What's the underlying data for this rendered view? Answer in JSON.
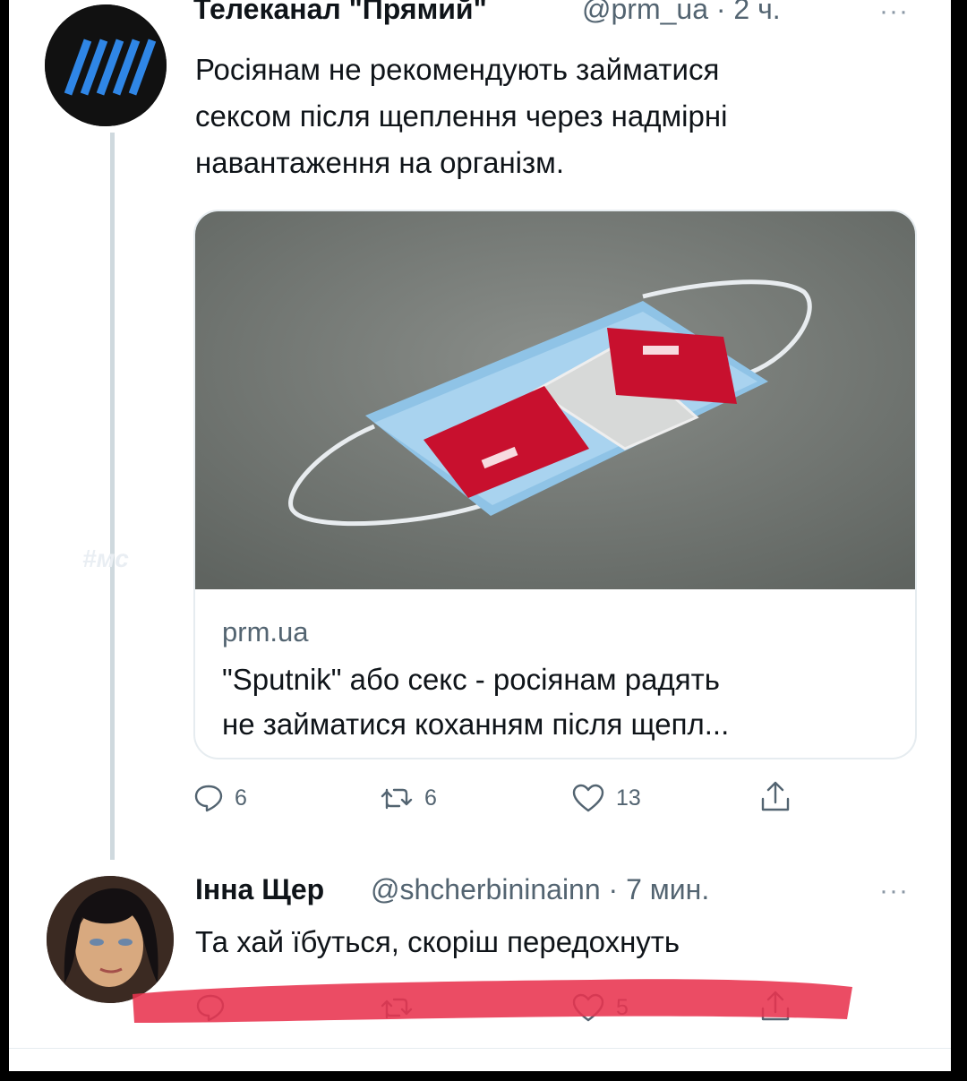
{
  "tweet1": {
    "display_name": "Телеканал \"Прямий\"",
    "meta": "@prm_ua · 2 ч.",
    "more": "···",
    "text_lines": [
      "Росіянам не рекомендують займатися",
      "сексом після щеплення через надмірні",
      "навантаження на організм."
    ],
    "card": {
      "domain": "prm.ua",
      "title_lines": [
        "\"Sputnik\" або секс - росіянам радять",
        "не займатися коханням після щепл..."
      ]
    },
    "actions": {
      "reply_count": "6",
      "retweet_count": "6",
      "like_count": "13"
    }
  },
  "tweet2": {
    "display_name": "Інна Щер",
    "meta": "@shcherbininainn · 7 мин.",
    "more": "···",
    "text": "Та хай їбуться, скоріш передохнуть",
    "actions": {
      "like_count": "5"
    }
  },
  "watermark": "#мс",
  "icons": [
    "reply-icon",
    "retweet-icon",
    "like-icon",
    "share-icon"
  ],
  "colors": {
    "scribble": "#e8334f",
    "muted": "#536471",
    "text": "#0f1419",
    "thread_line": "#cfd9de"
  }
}
